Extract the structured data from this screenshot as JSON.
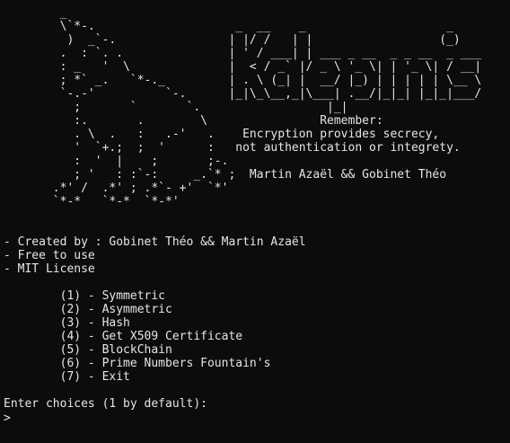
{
  "colors": {
    "background": "#0c0c0c",
    "foreground": "#e6e6e6"
  },
  "banner": [
    "        _",
    "        \\`*-.                    _  __    _                    _",
    "         )  _`-.                | |/ /   | |                  (_)",
    "        .  : `. .               | ' / ___| | ___ _ __  _ _ __  _ ___",
    "        : _   '  \\              |  < / _` |/ _ \\ '_ \\| | '_ \\| / __|",
    "        ; *` _.   `*-._         | . \\ (_| |  __/ |_) | | | | | \\__ \\",
    "        `-.-'          `-.      |_|\\_\\__,_|\\___| .__/|_|_| |_|_|___/",
    "          ;       `       `.                  |_|",
    "          :.       .        \\                Remember:",
    "          . \\  .   :   .-'   .    Encryption provides secrecy,",
    "          '  `+.;  ;  '      :   not authentication or integrety.",
    "          :  '  |    ;       ;-.",
    "          ; '   : :`-:     _.`* ;  Martin Azaël && Gobinet Théo",
    "       .*' /  .*' ; .*`- +'  `*'",
    "       `*-*   `*-*  `*-*'"
  ],
  "info": [
    "- Created by : Gobinet Théo && Martin Azaël",
    "- Free to use",
    "- MIT License"
  ],
  "menu": [
    "        (1) - Symmetric",
    "        (2) - Asymmetric",
    "        (3) - Hash",
    "        (4) - Get X509 Certificate",
    "        (5) - BlockChain",
    "        (6) - Prime Numbers Fountain's",
    "        (7) - Exit"
  ],
  "prompt": {
    "question": "Enter choices (1 by default):",
    "caret": ">"
  }
}
